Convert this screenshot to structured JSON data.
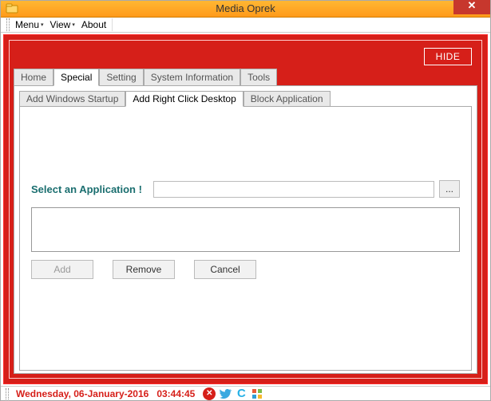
{
  "window": {
    "title": "Media Oprek"
  },
  "menubar": {
    "menu": "Menu",
    "view": "View",
    "about": "About"
  },
  "hide_label": "HIDE",
  "tabs": {
    "main": [
      "Home",
      "Special",
      "Setting",
      "System Information",
      "Tools"
    ],
    "main_active_index": 1,
    "sub": [
      "Add Windows Startup",
      "Add Right Click Desktop",
      "Block Application"
    ],
    "sub_active_index": 1
  },
  "form": {
    "select_label": "Select an Application !",
    "input_value": "",
    "browse_label": "...",
    "add_label": "Add",
    "remove_label": "Remove",
    "cancel_label": "Cancel"
  },
  "statusbar": {
    "date": "Wednesday, 06-January-2016",
    "time": "03:44:45"
  }
}
